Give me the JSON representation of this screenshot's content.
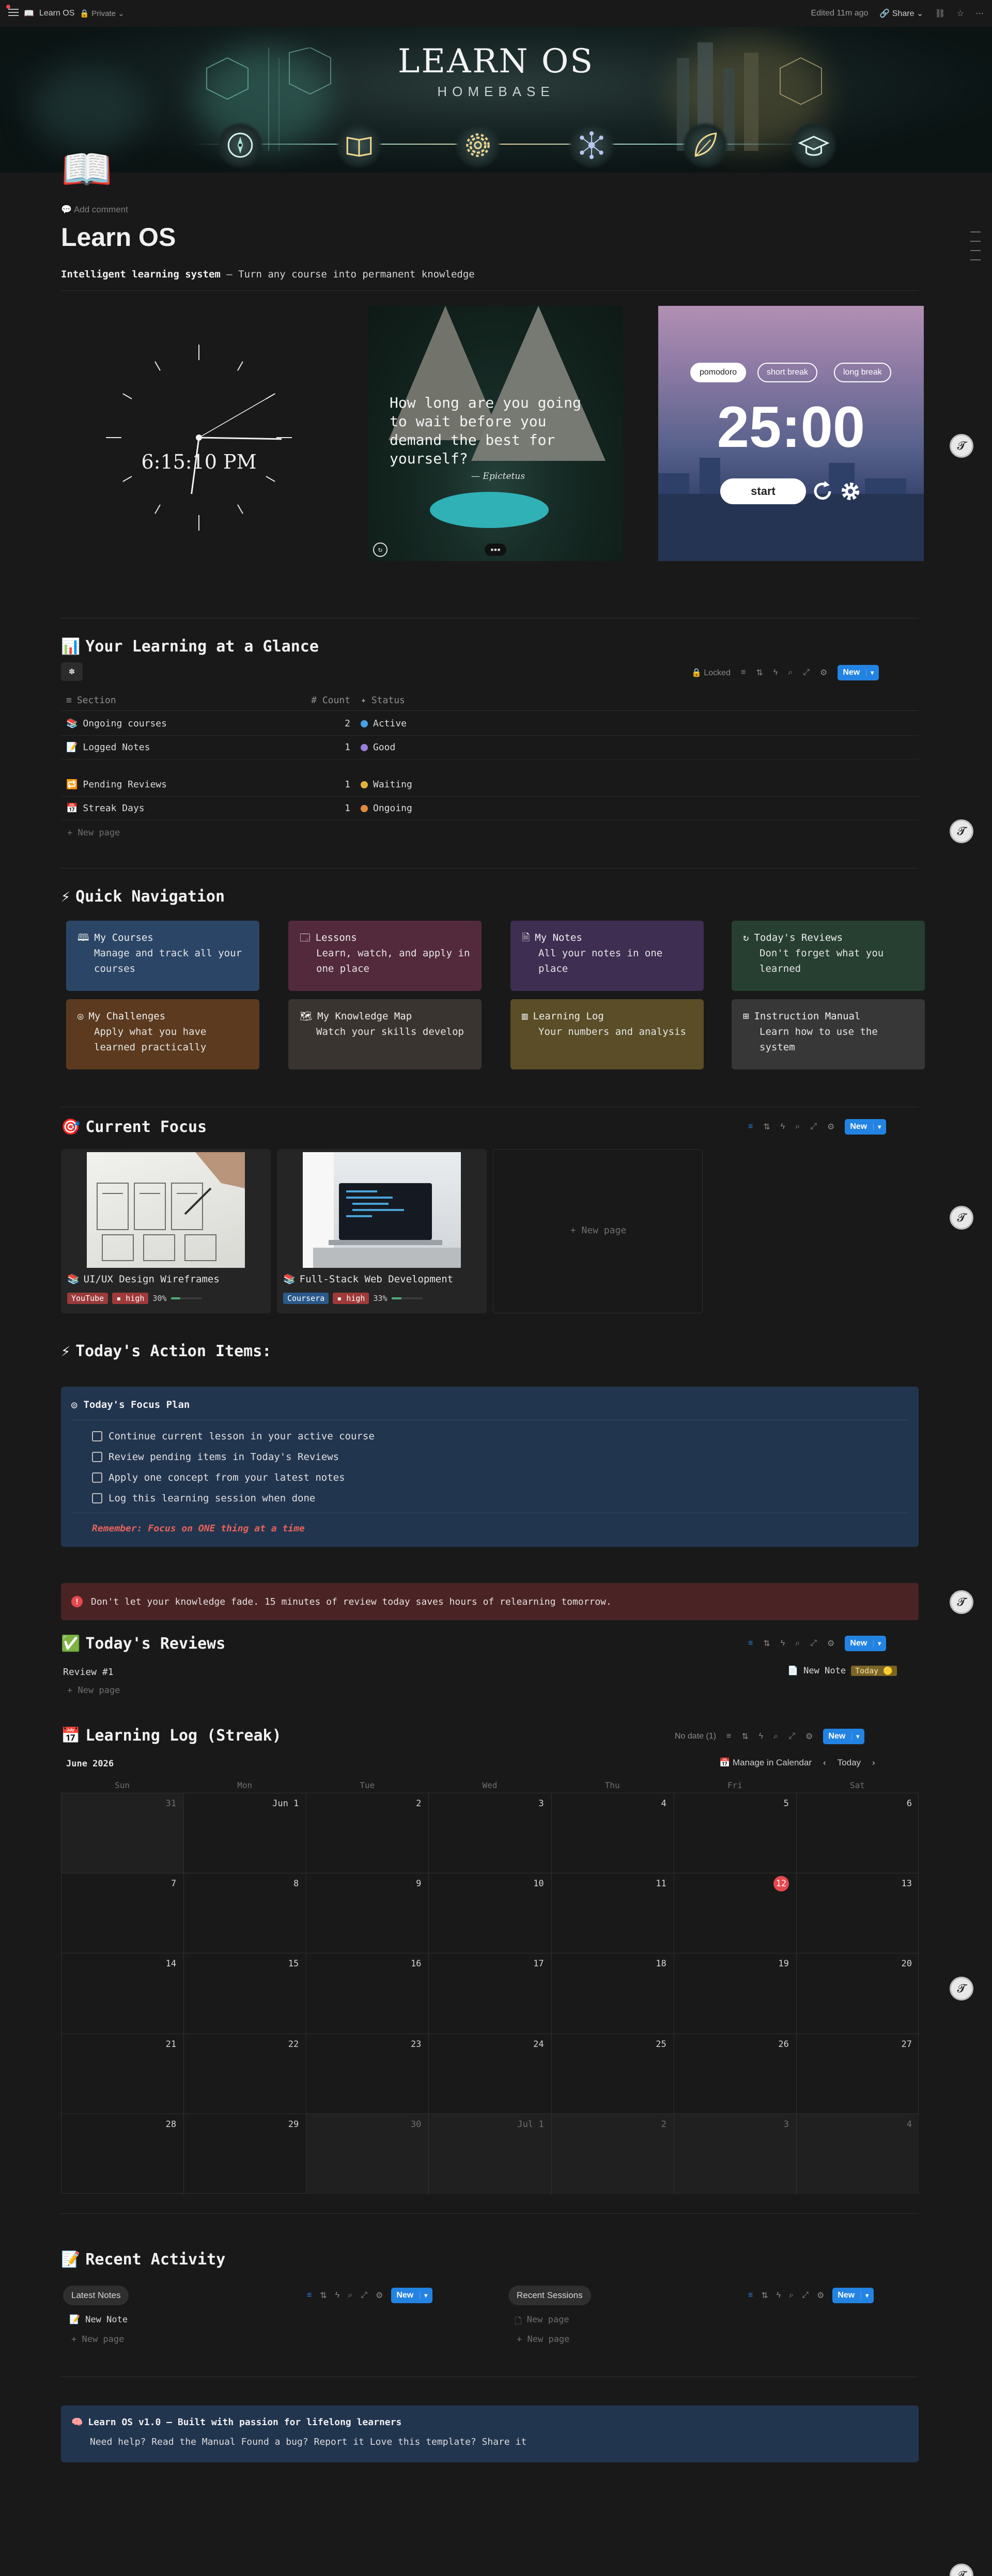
{
  "topbar": {
    "page_name": "Learn OS",
    "privacy": "Private",
    "edited": "Edited 11m ago",
    "share": "Share"
  },
  "banner": {
    "title": "LEARN OS",
    "subtitle": "HOMEBASE",
    "icons": [
      "compass-icon",
      "book-icon",
      "gear-icon",
      "network-icon",
      "leaf-icon",
      "graduation-cap-icon"
    ]
  },
  "page": {
    "add_comment": "Add comment",
    "title": "Learn OS",
    "tagline_bold": "Intelligent learning system",
    "tagline_rest": " — Turn any course into permanent knowledge"
  },
  "widgets": {
    "clock_time": "6:15:10 PM",
    "quote": "How long are you going to wait before you demand the best for yourself?",
    "quote_author": "— Epictetus",
    "pomodoro": {
      "modes": [
        "pomodoro",
        "short break",
        "long break"
      ],
      "active_mode": "pomodoro",
      "time": "25:00",
      "start": "start"
    }
  },
  "glance": {
    "title": "Your Learning at a Glance",
    "locked": "Locked",
    "new": "New",
    "headers": [
      "Section",
      "Count",
      "Status"
    ],
    "rows": [
      {
        "section": "Ongoing courses",
        "count": "2",
        "status": "Active",
        "color": "#4a9fe8"
      },
      {
        "section": "Logged Notes",
        "count": "1",
        "status": "Good",
        "color": "#9a7fd8"
      },
      {
        "section": "Pending Reviews",
        "count": "1",
        "status": "Waiting",
        "color": "#e3b03b"
      },
      {
        "section": "Streak Days",
        "count": "1",
        "status": "Ongoing",
        "color": "#e38a3b"
      }
    ],
    "new_page": "+ New page"
  },
  "quicknav": {
    "title": "Quick Navigation",
    "cards": [
      {
        "title": "My Courses",
        "desc": "Manage and track all your courses",
        "bg": "#2b4566"
      },
      {
        "title": "Lessons",
        "desc": "Learn, watch, and apply in one place",
        "bg": "#532a3b"
      },
      {
        "title": "My Notes",
        "desc": "All your notes in one place",
        "bg": "#3e2e52"
      },
      {
        "title": "Today's Reviews",
        "desc": "Don't forget what you learned",
        "bg": "#263f31"
      },
      {
        "title": "My Challenges",
        "desc": "Apply what you have learned practically",
        "bg": "#5b3a1f"
      },
      {
        "title": "My Knowledge Map",
        "desc": "Watch your skills develop",
        "bg": "#3a3430"
      },
      {
        "title": "Learning Log",
        "desc": "Your numbers and analysis",
        "bg": "#5a4d27"
      },
      {
        "title": "Instruction Manual",
        "desc": "Learn how to use the system",
        "bg": "#373737"
      }
    ]
  },
  "focus": {
    "title": "Current Focus",
    "new": "New",
    "cards": [
      {
        "title": "UI/UX Design Wireframes",
        "platform": "YouTube",
        "platform_color": "#9b3b3b",
        "priority": "high",
        "progress": 30,
        "progress_label": "30%"
      },
      {
        "title": "Full-Stack Web Development",
        "platform": "Coursera",
        "platform_color": "#2b5a8a",
        "priority": "high",
        "progress": 33,
        "progress_label": "33%"
      }
    ],
    "new_page": "+ New page"
  },
  "actions": {
    "title": "Today's Action Items:",
    "plan_title": "Today's Focus Plan",
    "items": [
      "Continue current lesson in your active course",
      "Review pending items in Today's Reviews",
      "Apply one concept from your latest notes",
      "Log this learning session when done"
    ],
    "reminder": "Remember: Focus on ONE thing at a time"
  },
  "warning": "Don't let your knowledge fade. 15 minutes of review today saves hours of relearning tomorrow.",
  "reviews": {
    "title": "Today's Reviews",
    "new": "New",
    "row_name": "Review #1",
    "row_note": "New Note",
    "row_badge": "Today",
    "new_page": "+ New page"
  },
  "log": {
    "title": "Learning Log (Streak)",
    "no_date": "No date (1)",
    "new": "New",
    "month": "June 2026",
    "manage": "Manage in Calendar",
    "today": "Today",
    "days": [
      "Sun",
      "Mon",
      "Tue",
      "Wed",
      "Thu",
      "Fri",
      "Sat"
    ],
    "cells": [
      "31",
      "Jun 1",
      "2",
      "3",
      "4",
      "5",
      "6",
      "7",
      "8",
      "9",
      "10",
      "11",
      "12",
      "13",
      "14",
      "15",
      "16",
      "17",
      "18",
      "19",
      "20",
      "21",
      "22",
      "23",
      "24",
      "25",
      "26",
      "27",
      "28",
      "29",
      "30",
      "Jul 1",
      "2",
      "3",
      "4"
    ],
    "today_index": 12
  },
  "recent": {
    "title": "Recent Activity",
    "notes_tab": "Latest Notes",
    "sessions_tab": "Recent Sessions",
    "new": "New",
    "note_item": "New Note",
    "session_item": "New page",
    "new_page": "+ New page"
  },
  "footer": {
    "title": "Learn OS v1.0 — Built with passion for lifelong learners",
    "text": "Need help? Read the Manual Found a bug? Report it Love this template? Share it"
  }
}
